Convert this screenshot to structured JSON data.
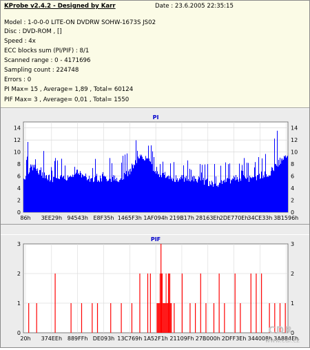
{
  "info": {
    "title": "KProbe v2.4.2 - Designed by Karr",
    "date": "Date : 23.6.2005 22:35:15",
    "lines": [
      "Model : 1-0-0-0 LITE-ON DVDRW SOHW-1673S JS02",
      "Disc : DVD-ROM ,  []",
      "Speed : 4x",
      "ECC blocks sum (PI/PIF) : 8/1",
      "Scanned range : 0 - 4171696",
      "Sampling count : 224748",
      "Errors : 0",
      "PI Max= 15 , Average= 1,89 , Total= 60124",
      "PIF Max= 3 , Average= 0,01 , Total= 1550"
    ]
  },
  "colors": {
    "pi": "#0000ff",
    "pif": "#ff0000",
    "title": "#0000cc",
    "info_bg": "#fbfbe6",
    "panel_bg": "#ececec"
  },
  "watermark": {
    "line1": "CDR",
    "line2": "www.cdr.cz"
  },
  "chart_data": [
    {
      "type": "bar",
      "title": "PI",
      "ylim": [
        0,
        15
      ],
      "yticks": [
        0,
        2,
        4,
        6,
        8,
        10,
        12,
        14
      ],
      "xlim_hex": [
        0,
        4171696
      ],
      "xtick_labels": [
        "86h",
        "3EE29h",
        "94543h",
        "E8F35h",
        "1465F3h",
        "1AF094h",
        "219B17h",
        "28163Eh",
        "2DE770Eh",
        "34CE33h",
        "3B1596h"
      ],
      "grid": true,
      "max": 15,
      "average": 1.89,
      "profile": [
        {
          "x": 0.0,
          "base": 5,
          "peak": 11
        },
        {
          "x": 0.03,
          "base": 7,
          "peak": 13
        },
        {
          "x": 0.06,
          "base": 6,
          "peak": 11
        },
        {
          "x": 0.1,
          "base": 5,
          "peak": 9
        },
        {
          "x": 0.15,
          "base": 5,
          "peak": 9
        },
        {
          "x": 0.2,
          "base": 6,
          "peak": 9
        },
        {
          "x": 0.25,
          "base": 5,
          "peak": 10
        },
        {
          "x": 0.3,
          "base": 5,
          "peak": 9
        },
        {
          "x": 0.36,
          "base": 5,
          "peak": 9
        },
        {
          "x": 0.4,
          "base": 6,
          "peak": 10
        },
        {
          "x": 0.44,
          "base": 9,
          "peak": 15
        },
        {
          "x": 0.47,
          "base": 8,
          "peak": 13
        },
        {
          "x": 0.5,
          "base": 6,
          "peak": 10
        },
        {
          "x": 0.55,
          "base": 5,
          "peak": 9
        },
        {
          "x": 0.6,
          "base": 5,
          "peak": 9
        },
        {
          "x": 0.65,
          "base": 5,
          "peak": 8
        },
        {
          "x": 0.72,
          "base": 4,
          "peak": 8
        },
        {
          "x": 0.8,
          "base": 5,
          "peak": 9
        },
        {
          "x": 0.88,
          "base": 5,
          "peak": 9
        },
        {
          "x": 0.93,
          "base": 6,
          "peak": 10
        },
        {
          "x": 0.97,
          "base": 8,
          "peak": 15
        },
        {
          "x": 1.0,
          "base": 9,
          "peak": 14
        }
      ]
    },
    {
      "type": "bar",
      "title": "PIF",
      "ylim": [
        0,
        3
      ],
      "yticks": [
        0,
        1,
        2,
        3
      ],
      "xlim_hex": [
        0,
        4171696
      ],
      "xtick_labels": [
        "20h",
        "374EEh",
        "889FFh",
        "DE093h",
        "13C769h",
        "1A52F1h",
        "21109Fh",
        "27B000h",
        "2DFF3Eh",
        "344008h",
        "3A884Eh"
      ],
      "grid": true,
      "max": 3,
      "average": 0.01,
      "spikes": [
        {
          "x": 0.02,
          "y": 1
        },
        {
          "x": 0.05,
          "y": 1
        },
        {
          "x": 0.12,
          "y": 2
        },
        {
          "x": 0.18,
          "y": 1
        },
        {
          "x": 0.22,
          "y": 1
        },
        {
          "x": 0.26,
          "y": 1
        },
        {
          "x": 0.28,
          "y": 1
        },
        {
          "x": 0.33,
          "y": 1
        },
        {
          "x": 0.37,
          "y": 1
        },
        {
          "x": 0.41,
          "y": 1
        },
        {
          "x": 0.44,
          "y": 2
        },
        {
          "x": 0.47,
          "y": 2
        },
        {
          "x": 0.48,
          "y": 2
        },
        {
          "x": 0.52,
          "y": 3
        },
        {
          "x": 0.55,
          "y": 2
        },
        {
          "x": 0.57,
          "y": 1
        },
        {
          "x": 0.6,
          "y": 2
        },
        {
          "x": 0.63,
          "y": 1
        },
        {
          "x": 0.65,
          "y": 1
        },
        {
          "x": 0.67,
          "y": 2
        },
        {
          "x": 0.69,
          "y": 1
        },
        {
          "x": 0.72,
          "y": 1
        },
        {
          "x": 0.74,
          "y": 2
        },
        {
          "x": 0.76,
          "y": 1
        },
        {
          "x": 0.8,
          "y": 2
        },
        {
          "x": 0.82,
          "y": 1
        },
        {
          "x": 0.86,
          "y": 2
        },
        {
          "x": 0.88,
          "y": 2
        },
        {
          "x": 0.9,
          "y": 2
        },
        {
          "x": 0.93,
          "y": 1
        },
        {
          "x": 0.95,
          "y": 1
        },
        {
          "x": 0.97,
          "y": 1
        },
        {
          "x": 0.99,
          "y": 1
        }
      ],
      "dense_region": {
        "x_from": 0.505,
        "x_to": 0.56,
        "y": 1
      }
    }
  ]
}
